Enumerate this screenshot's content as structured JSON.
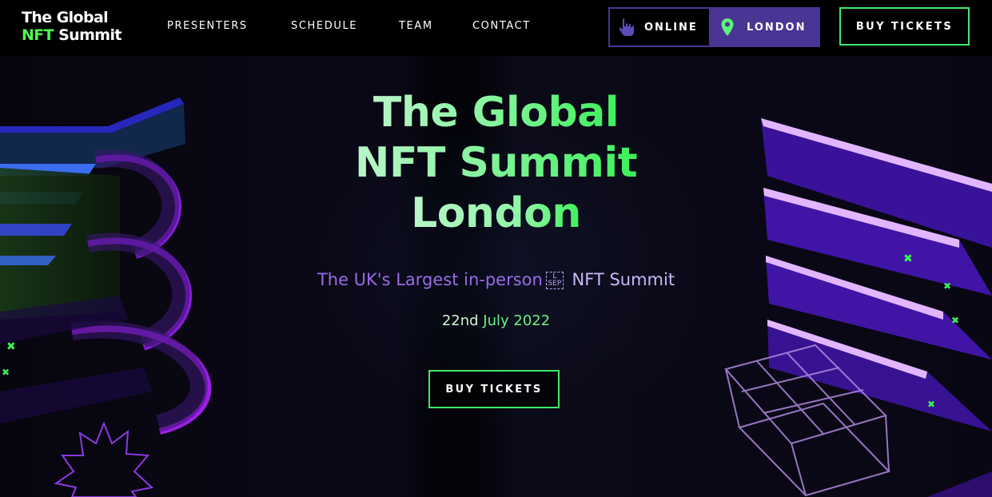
{
  "header": {
    "logo": {
      "line1": "The Global",
      "nft": "NFT",
      "summit": "Summit"
    },
    "nav": [
      "PRESENTERS",
      "SCHEDULE",
      "TEAM",
      "CONTACT"
    ],
    "mode_toggle": {
      "online": "ONLINE",
      "london": "LONDON",
      "online_icon": "pointer-hand-icon",
      "london_icon": "map-pin-icon"
    },
    "buy_tickets": "BUY TICKETS"
  },
  "hero": {
    "title": {
      "line1_a": "The ",
      "line1_b": "Global",
      "line2_a": "NFT ",
      "line2_b": "Summit",
      "line3_a": "Lond",
      "line3_b": "on"
    },
    "subtitle_main": "The UK's Largest in-person",
    "subtitle_sep": "L SEP",
    "subtitle_tail": " NFT Summit",
    "date_a": "22nd ",
    "date_b": "July 2022",
    "buy_tickets": "BUY TICKETS"
  },
  "colors": {
    "accent_green": "#3ee86a",
    "accent_purple": "#4a3595",
    "subtitle_purple": "#9a6be8",
    "background": "#000000"
  }
}
